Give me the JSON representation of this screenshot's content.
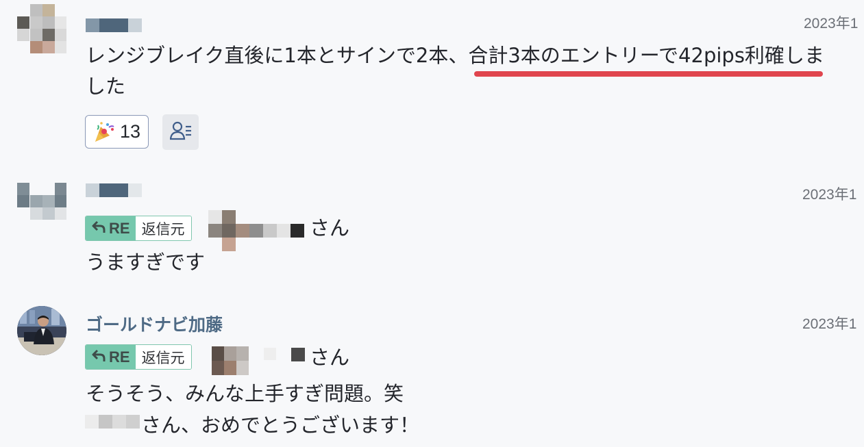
{
  "messages": [
    {
      "timestamp": "2023年1",
      "text_line1_prefix": "レンジブレイク直後に1本とサインで2本、",
      "text_line1_highlight": "合計3本のエントリーで42pips利確",
      "text_line1_suffix": "しま",
      "text_line2": "した",
      "highlight_color": "#e0454e",
      "reaction": {
        "emoji_name": "party-popper-icon",
        "count": "13"
      },
      "reactor_list_icon": "user-list-icon"
    },
    {
      "timestamp": "2023年1",
      "reply_chip": {
        "re_label": "RE",
        "origin_label": "返信元"
      },
      "mention_suffix": "さん",
      "text": "うますぎです"
    },
    {
      "author": "ゴールドナビ加藤",
      "timestamp": "2023年1",
      "reply_chip": {
        "re_label": "RE",
        "origin_label": "返信元"
      },
      "mention_suffix": "さん",
      "text_line1": "そうそう、みんな上手すぎ問題。笑",
      "text_line2": "さん、おめでとうございます！"
    }
  ],
  "colors": {
    "background": "#f7f8fa",
    "author_name": "#4e6a85",
    "re_chip_green": "#76c8ad",
    "reaction_border": "#8a98b6",
    "timestamp": "#6b6f76"
  }
}
